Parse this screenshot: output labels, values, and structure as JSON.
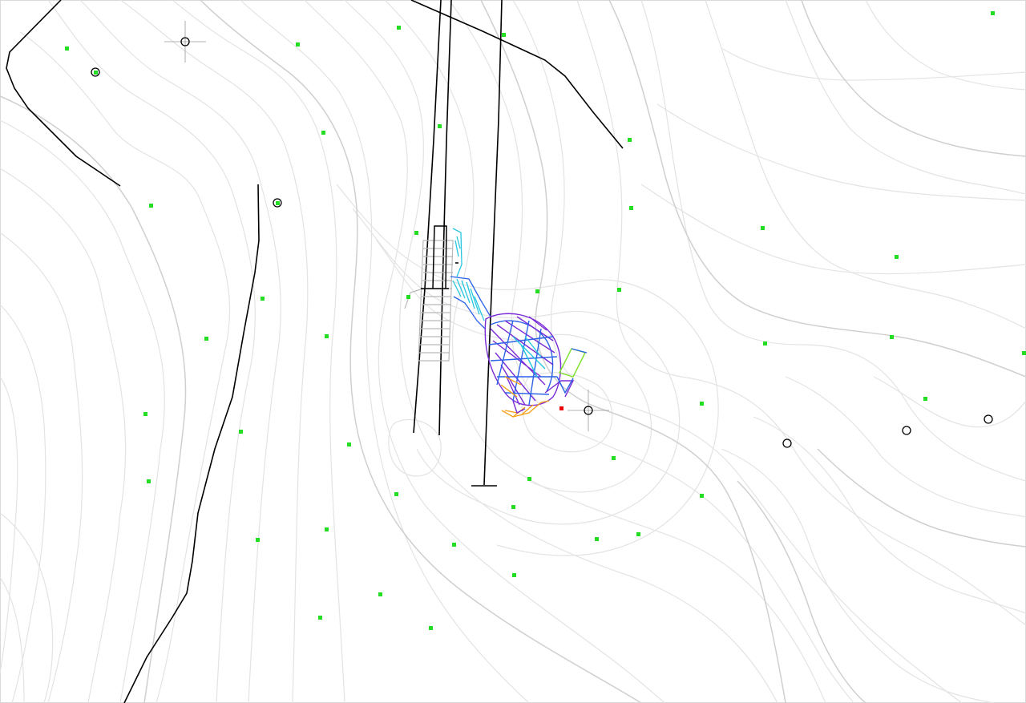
{
  "colors": {
    "background": "#ffffff",
    "border": "#d9d9d9",
    "contour_minor": "#e3e3e3",
    "contour_major": "#cfcfcf",
    "boundary_line": "#000000",
    "survey_point": "#22dd22",
    "marker_point": "#ee0000",
    "structure_purple": "#7a2bd6",
    "structure_blue": "#2a62e8",
    "structure_cyan": "#27c6e0",
    "structure_orange": "#f5a21a",
    "structure_green": "#7ee02a",
    "structure_gray": "#b9b9b9"
  },
  "icons": {
    "crosshair": "crosshair-icon",
    "ring": "ring-marker-icon",
    "survey": "survey-point-icon"
  }
}
